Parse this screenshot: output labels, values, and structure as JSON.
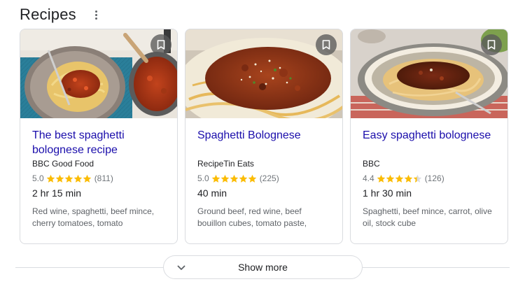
{
  "header": {
    "title": "Recipes"
  },
  "cards": [
    {
      "title": "The best spaghetti bolognese recipe",
      "source": "BBC Good Food",
      "rating": "5.0",
      "stars": 5,
      "count": "(811)",
      "time": "2 hr 15 min",
      "ingredients": "Red wine, spaghetti, beef mince, cherry tomatoes, tomato"
    },
    {
      "title": "Spaghetti Bolognese",
      "source": "RecipeTin Eats",
      "rating": "5.0",
      "stars": 5,
      "count": "(225)",
      "time": "40 min",
      "ingredients": "Ground beef, red wine, beef bouillon cubes, tomato paste,"
    },
    {
      "title": "Easy spaghetti bolognese",
      "source": "BBC",
      "rating": "4.4",
      "stars": 4.4,
      "count": "(126)",
      "time": "1 hr 30 min",
      "ingredients": "Spaghetti, beef mince, carrot, olive oil, stock cube"
    }
  ],
  "footer": {
    "show_more": "Show more"
  },
  "colors": {
    "link": "#1a0dab",
    "star": "#fbbc04",
    "border": "#dadce0"
  }
}
